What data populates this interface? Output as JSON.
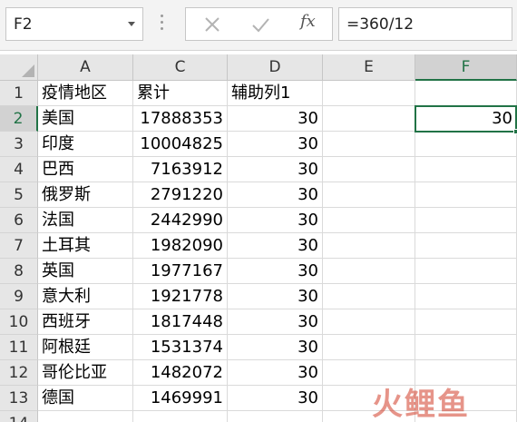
{
  "formula_bar": {
    "name_box": "F2",
    "formula": "=360/12",
    "icons": [
      "cancel-icon",
      "enter-icon",
      "function-icon"
    ],
    "fx_label": "fx"
  },
  "columns": [
    "A",
    "C",
    "D",
    "E",
    "F"
  ],
  "rows": [
    "1",
    "2",
    "3",
    "4",
    "5",
    "6",
    "7",
    "8",
    "9",
    "10",
    "11",
    "12",
    "13",
    "14"
  ],
  "headers": {
    "A": "疫情地区",
    "C": "累计",
    "D": "辅助列1"
  },
  "data": [
    {
      "A": "美国",
      "C": "17888353",
      "D": "30"
    },
    {
      "A": "印度",
      "C": "10004825",
      "D": "30"
    },
    {
      "A": "巴西",
      "C": "7163912",
      "D": "30"
    },
    {
      "A": "俄罗斯",
      "C": "2791220",
      "D": "30"
    },
    {
      "A": "法国",
      "C": "2442990",
      "D": "30"
    },
    {
      "A": "土耳其",
      "C": "1982090",
      "D": "30"
    },
    {
      "A": "英国",
      "C": "1977167",
      "D": "30"
    },
    {
      "A": "意大利",
      "C": "1921778",
      "D": "30"
    },
    {
      "A": "西班牙",
      "C": "1817448",
      "D": "30"
    },
    {
      "A": "阿根廷",
      "C": "1531374",
      "D": "30"
    },
    {
      "A": "哥伦比亚",
      "C": "1482072",
      "D": "30"
    },
    {
      "A": "德国",
      "C": "1469991",
      "D": "30"
    }
  ],
  "selected_cell": {
    "ref": "F2",
    "value": "30"
  },
  "colors": {
    "accent": "#217346",
    "header_bg": "#e6e6e6",
    "gridline": "#dadada"
  },
  "watermark": "火鲤鱼"
}
